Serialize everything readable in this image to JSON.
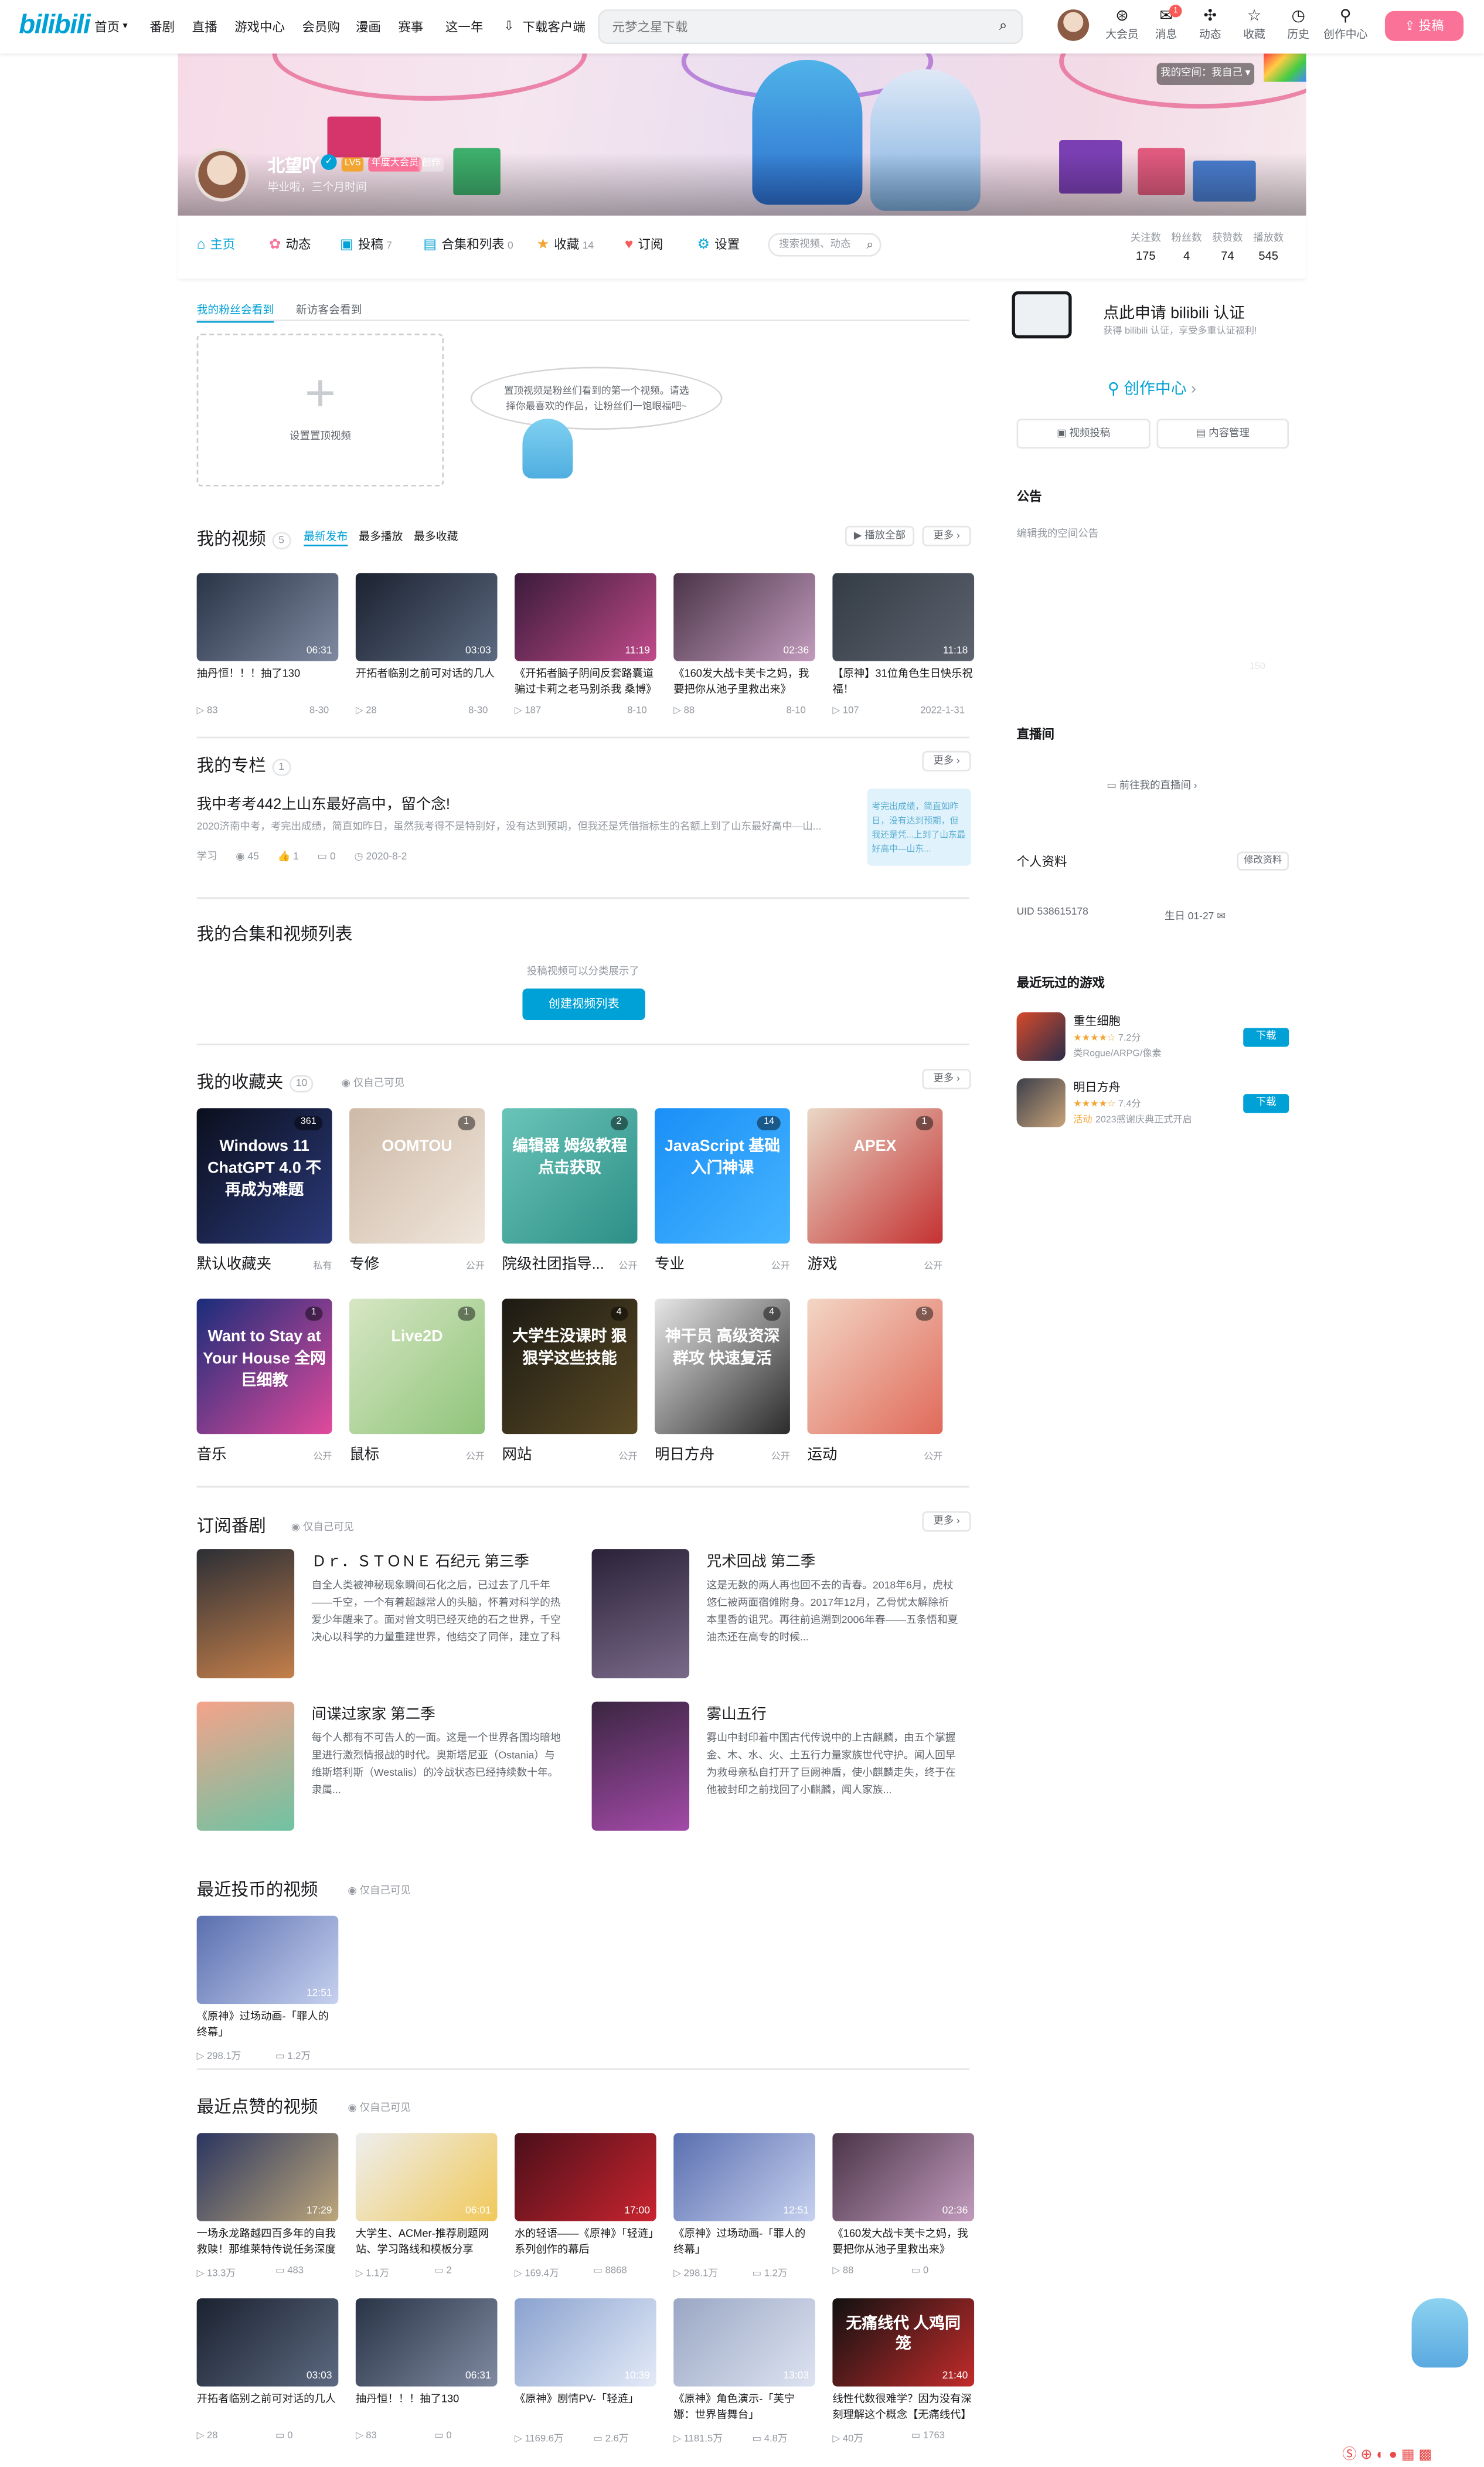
{
  "header": {
    "logo": "bilibili",
    "nav": [
      "首页",
      "番剧",
      "直播",
      "游戏中心",
      "会员购",
      "漫画",
      "赛事",
      "这一年",
      "下载客户端"
    ],
    "search_placeholder": "元梦之星下载",
    "icons": [
      {
        "name": "大会员",
        "icon": "vip-icon"
      },
      {
        "name": "消息",
        "icon": "message-icon",
        "badge": "1"
      },
      {
        "name": "动态",
        "icon": "dynamic-icon"
      },
      {
        "name": "收藏",
        "icon": "star-icon"
      },
      {
        "name": "历史",
        "icon": "clock-icon"
      },
      {
        "name": "创作中心",
        "icon": "bulb-icon"
      }
    ],
    "upload": "投稿",
    "accent": "#fb7299"
  },
  "profile": {
    "name": "北望吖",
    "sign": "毕业啦，三个月时间",
    "level": "LV5",
    "vip": "年度大会员",
    "badge": "创作",
    "switch": "我的空间：我自己 ▾"
  },
  "tabs": [
    {
      "label": "主页",
      "count": ""
    },
    {
      "label": "动态",
      "count": ""
    },
    {
      "label": "投稿",
      "count": "7"
    },
    {
      "label": "合集和列表",
      "count": "0"
    },
    {
      "label": "收藏",
      "count": "14"
    },
    {
      "label": "订阅",
      "count": ""
    },
    {
      "label": "设置",
      "count": ""
    }
  ],
  "tab_search_placeholder": "搜索视频、动态",
  "stats": [
    {
      "k": "关注数",
      "v": "175"
    },
    {
      "k": "粉丝数",
      "v": "4"
    },
    {
      "k": "获赞数",
      "v": "74"
    },
    {
      "k": "播放数",
      "v": "545"
    }
  ],
  "top_video": {
    "tabs": [
      "我的粉丝会看到",
      "新访客会看到"
    ],
    "set_label": "设置置顶视频",
    "bubble": "置顶视频是粉丝们看到的第一个视频。请选择你最喜欢的作品，让粉丝们一饱眼福吧~"
  },
  "my_videos": {
    "title": "我的视频",
    "count": "5",
    "sort": [
      "最新发布",
      "最多播放",
      "最多收藏"
    ],
    "play_all": "播放全部",
    "more": "更多",
    "items": [
      {
        "title": "抽丹恒！！！抽了130",
        "dur": "06:31",
        "plays": "83",
        "date": "8-30",
        "c1": "#2a3447",
        "c2": "#7f8aa1"
      },
      {
        "title": "开拓者临别之前可对话的几人",
        "dur": "03:03",
        "plays": "28",
        "date": "8-30",
        "c1": "#1b2230",
        "c2": "#5c6980"
      },
      {
        "title": "《开拓者脑子阴间反套路囊道骗过卡莉之老马别杀我 桑博》",
        "dur": "11:19",
        "plays": "187",
        "date": "8-10",
        "c1": "#3a1b3a",
        "c2": "#c04a8a"
      },
      {
        "title": "《160发大战卡芙卡之妈，我要把你从池子里救出来》",
        "dur": "02:36",
        "plays": "88",
        "date": "8-10",
        "c1": "#4a3448",
        "c2": "#c29bbd"
      },
      {
        "title": "【原神】31位角色生日快乐祝福！",
        "dur": "11:18",
        "plays": "107",
        "date": "2022-1-31",
        "c1": "#333b44",
        "c2": "#5d6470"
      }
    ]
  },
  "column": {
    "title": "我的专栏",
    "count": "1",
    "more": "更多",
    "article_title": "我中考考442上山东最好高中，留个念!",
    "summary": "2020济南中考，考完出成绩，简直如昨日，虽然我考得不是特别好，没有达到预期，但我还是凭借指标生的名额上到了山东最好高中—山...",
    "category": "学习",
    "views": "45",
    "likes": "1",
    "comments": "0",
    "date": "2020-8-2",
    "thumb_text": "考完出成绩，简直如昨日，没有达到预期，但我还是凭...上到了山东最好高中—山东..."
  },
  "collections": {
    "title": "我的合集和视频列表",
    "hint": "投稿视频可以分类展示了",
    "button": "创建视频列表"
  },
  "favorites": {
    "title": "我的收藏夹",
    "count": "10",
    "visibility": "仅自己可见",
    "more": "更多",
    "items": [
      {
        "name": "默认收藏夹",
        "cnt": "361",
        "pub": "私有",
        "text": "Windows 11 ChatGPT 4.0 不再成为难题",
        "c1": "#0b0f1d",
        "c2": "#2b3a7a"
      },
      {
        "name": "专修",
        "cnt": "1",
        "pub": "公开",
        "text": "OOMTOU",
        "c1": "#cdb9a6",
        "c2": "#f0e6dc"
      },
      {
        "name": "院级社团指导...",
        "cnt": "2",
        "pub": "公开",
        "text": "编辑器 姆级教程 点击获取",
        "c1": "#6ac4b8",
        "c2": "#2c8f87"
      },
      {
        "name": "专业",
        "cnt": "14",
        "pub": "公开",
        "text": "JavaScript 基础入门神课",
        "c1": "#1a8ff7",
        "c2": "#46b5ff"
      },
      {
        "name": "游戏",
        "cnt": "1",
        "pub": "公开",
        "text": "APEX",
        "c1": "#e9d8c6",
        "c2": "#c43232"
      },
      {
        "name": "音乐",
        "cnt": "1",
        "pub": "公开",
        "text": "Want to Stay at Your House 全网巨细教",
        "c1": "#1a2d7a",
        "c2": "#e14a9c"
      },
      {
        "name": "鼠标",
        "cnt": "1",
        "pub": "公开",
        "text": "Live2D",
        "c1": "#d7e6c4",
        "c2": "#8fc47a"
      },
      {
        "name": "网站",
        "cnt": "4",
        "pub": "公开",
        "text": "大学生没课时 狠狠学这些技能",
        "c1": "#1c1a14",
        "c2": "#5a4a24"
      },
      {
        "name": "明日方舟",
        "cnt": "4",
        "pub": "公开",
        "text": "神干员 高级资深 群攻 快速复活",
        "c1": "#e7e7e7",
        "c2": "#2b2b2b"
      },
      {
        "name": "运动",
        "cnt": "5",
        "pub": "公开",
        "text": "",
        "c1": "#f3d6c5",
        "c2": "#e06a5a"
      }
    ]
  },
  "bangumi": {
    "title": "订阅番剧",
    "visibility": "仅自己可见",
    "more": "更多",
    "items": [
      {
        "title": "Ｄｒ．ＳＴＯＮＥ 石纪元 第三季",
        "desc": "自全人类被神秘现象瞬间石化之后，已过去了几千年——千空，一个有着超越常人的头脑，怀着对科学的热爱少年醒来了。面对曾文明已经灭绝的石之世界，千空决心以科学的力量重建世界，他结交了同伴，建立了科学王国...",
        "c1": "#2c2f36",
        "c2": "#c47f4a"
      },
      {
        "title": "咒术回战 第二季",
        "desc": "这是无数的两人再也回不去的青春。2018年6月，虎杖悠仁被两面宿傩附身。2017年12月，乙骨忧太解除祈本里香的诅咒。再往前追溯到2006年春——五条悟和夏油杰还在高专的时候...",
        "c1": "#2a2238",
        "c2": "#7a6a8a"
      },
      {
        "title": "间谍过家家 第二季",
        "desc": "每个人都有不可告人的一面。这是一个世界各国均暗地里进行激烈情报战的时代。奥斯塔尼亚（Ostania）与维斯塔利斯（Westalis）的冷战状态已经持续数十年。隶属...",
        "c1": "#f4a38a",
        "c2": "#6ec3a3"
      },
      {
        "title": "雾山五行",
        "desc": "雾山中封印着中国古代传说中的上古麒麟，由五个掌握金、木、水、火、土五行力量家族世代守护。闻人回早为救母亲私自打开了巨阙神盾，使小麒麟走失，终于在他被封印之前找回了小麒麟，闻人家族...",
        "c1": "#3b2642",
        "c2": "#a34aa8"
      }
    ]
  },
  "coins": {
    "title": "最近投币的视频",
    "visibility": "仅自己可见",
    "items": [
      {
        "title": "《原神》过场动画-「罪人的终幕」",
        "dur": "12:51",
        "plays": "298.1万",
        "danmaku": "1.2万",
        "c1": "#5a6fb0",
        "c2": "#c7d1ef"
      }
    ]
  },
  "likes": {
    "title": "最近点赞的视频",
    "visibility": "仅自己可见",
    "items": [
      {
        "title": "一场永龙路越四百多年的自我救赎！那维莱特传说任务深度",
        "dur": "17:29",
        "plays": "13.3万",
        "danmaku": "483",
        "c1": "#2a3560",
        "c2": "#bda77a"
      },
      {
        "title": "大学生、ACMer-推荐刷题网站、学习路线和模板分享",
        "dur": "06:01",
        "plays": "1.1万",
        "danmaku": "2",
        "c1": "#eeeeee",
        "c2": "#f0c95a"
      },
      {
        "title": "水的轻语——《原神》「轻涟」系列创作的幕后",
        "dur": "17:00",
        "plays": "169.4万",
        "danmaku": "8868",
        "c1": "#4a0f1a",
        "c2": "#c9242e"
      },
      {
        "title": "《原神》过场动画-「罪人的终幕」",
        "dur": "12:51",
        "plays": "298.1万",
        "danmaku": "1.2万",
        "c1": "#5a6fb0",
        "c2": "#c7d1ef"
      },
      {
        "title": "《160发大战卡芙卡之妈，我要把你从池子里救出来》",
        "dur": "02:36",
        "plays": "88",
        "danmaku": "0",
        "c1": "#4a3448",
        "c2": "#c29bbd"
      },
      {
        "title": "开拓者临别之前可对话的几人",
        "dur": "03:03",
        "plays": "28",
        "danmaku": "0",
        "c1": "#1b2230",
        "c2": "#5c6980"
      },
      {
        "title": "抽丹恒！！！抽了130",
        "dur": "06:31",
        "plays": "83",
        "danmaku": "0",
        "c1": "#2a3447",
        "c2": "#7f8aa1"
      },
      {
        "title": "《原神》剧情PV-「轻涟」",
        "dur": "10:39",
        "plays": "1169.6万",
        "danmaku": "2.6万",
        "c1": "#8aa2cf",
        "c2": "#e4ebf8"
      },
      {
        "title": "《原神》角色演示-「芙宁娜：世界皆舞台」",
        "dur": "13:03",
        "plays": "1181.5万",
        "danmaku": "4.8万",
        "c1": "#9aa7c4",
        "c2": "#dde3f1"
      },
      {
        "title": "线性代数很难学？因为没有深刻理解这个概念【无痛线代】",
        "dur": "21:40",
        "plays": "40万",
        "danmaku": "1763",
        "c1": "#111111",
        "c2": "#c32b2b",
        "text": "无痛线代 人鸡同笼"
      }
    ]
  },
  "sidebar": {
    "cert_title": "点此申请 bilibili 认证",
    "cert_sub": "获得 bilibili 认证，享受多重认证福利!",
    "creator": "创作中心",
    "upload_btn": "视频投稿",
    "manage_btn": "内容管理",
    "notice_title": "公告",
    "notice_placeholder": "编辑我的空间公告",
    "notice_counter": "150",
    "live_title": "直播间",
    "live_link": "前往我的直播间",
    "info_title": "个人资料",
    "info_edit": "修改资料",
    "uid": "UID  538615178",
    "birthday": "生日  01-27",
    "games_title": "最近玩过的游戏",
    "games": [
      {
        "name": "重生细胞",
        "stars": "7.2分",
        "tag": "类Rogue/ARPG/像素",
        "btn": "下载",
        "c1": "#d64a2a",
        "c2": "#2a2d4a"
      },
      {
        "name": "明日方舟",
        "stars": "7.4分",
        "tag": "2023感谢庆典正式开启",
        "tag_prefix": "活动",
        "btn": "下载",
        "c1": "#3c3f4a",
        "c2": "#c8a37a"
      }
    ]
  }
}
